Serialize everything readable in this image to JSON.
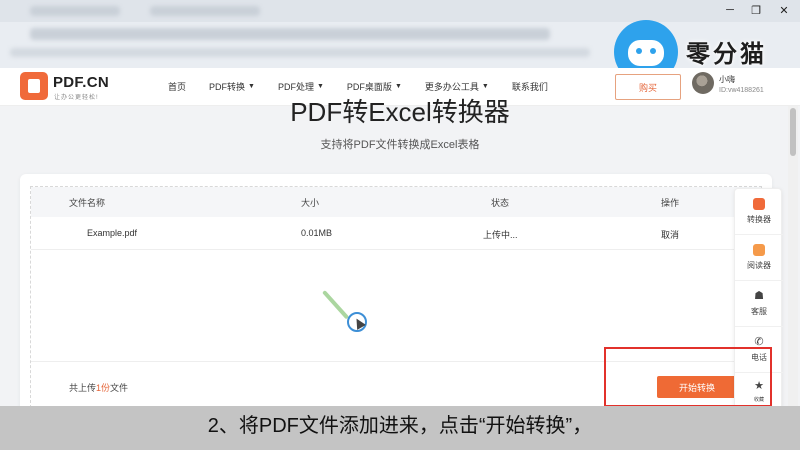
{
  "header": {
    "logo_text": "PDF.CN",
    "logo_sub": "让办公更轻松!",
    "nav": [
      {
        "label": "首页",
        "has_caret": false
      },
      {
        "label": "PDF转换",
        "has_caret": true
      },
      {
        "label": "PDF处理",
        "has_caret": true
      },
      {
        "label": "PDF桌面版",
        "has_caret": true
      },
      {
        "label": "更多办公工具",
        "has_caret": true
      },
      {
        "label": "联系我们",
        "has_caret": false
      }
    ],
    "buy_label": "购买",
    "user_name": "小嗨",
    "user_id": "ID:vw4188261"
  },
  "brand_watermark": "零分猫",
  "main": {
    "title": "PDF转Excel转换器",
    "subtitle": "支持将PDF文件转换成Excel表格"
  },
  "file_table": {
    "columns": [
      "文件名称",
      "大小",
      "状态",
      "操作"
    ],
    "rows": [
      {
        "name": "Example.pdf",
        "size": "0.01MB",
        "status": "上传中...",
        "action": "取消"
      }
    ],
    "count_prefix": "共上传",
    "count_num": "1份",
    "count_suffix": "文件",
    "start_label": "开始转换"
  },
  "sidebar": {
    "items": [
      {
        "label": "转换器",
        "icon": "converter-icon"
      },
      {
        "label": "阅读器",
        "icon": "reader-icon"
      },
      {
        "label": "客服",
        "icon": "service-icon"
      },
      {
        "label": "电话",
        "icon": "phone-icon"
      },
      {
        "label": "收藏",
        "icon": "star-icon"
      }
    ]
  },
  "caption": "2、将PDF文件添加进来，点击“开始转换”，",
  "colors": {
    "accent": "#ef6a35",
    "highlight": "#e2312b",
    "brand_blue": "#2ea2ec"
  }
}
